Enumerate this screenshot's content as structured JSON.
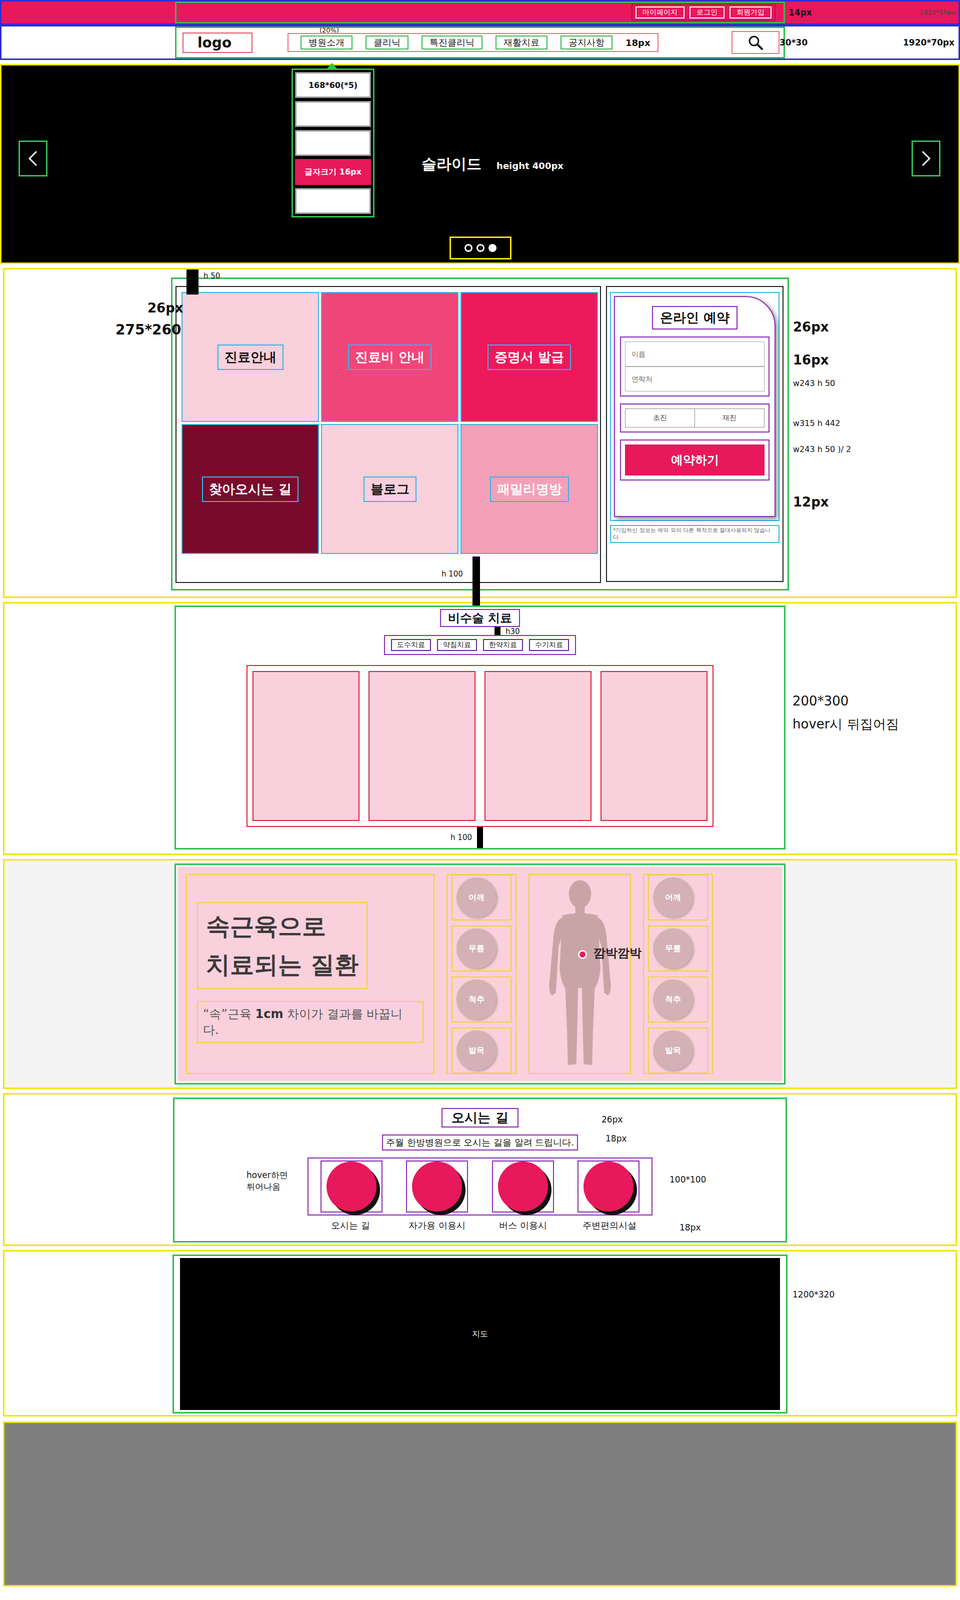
{
  "topBar": {
    "links": [
      {
        "label": "마이페이지"
      },
      {
        "label": "로그인"
      },
      {
        "label": "회원가입"
      }
    ],
    "fontNote": "14px",
    "sizeNote": "1920*50px"
  },
  "nav": {
    "logo": "logo",
    "items": [
      {
        "label": "병원소개",
        "expanded": true
      },
      {
        "label": "클리닉",
        "expanded": false
      },
      {
        "label": "특진클리닉",
        "expanded": false
      },
      {
        "label": "재활치료",
        "expanded": false
      },
      {
        "label": "공지사항",
        "expanded": false
      }
    ],
    "widthNote": "(20%)",
    "fontNote": "18px",
    "searchNote": "30*30",
    "sizeNote": "1920*70px"
  },
  "dropdown": {
    "items": [
      {
        "label": "168*60(*5)",
        "selected": false
      },
      {
        "label": "",
        "selected": false
      },
      {
        "label": "",
        "selected": false
      },
      {
        "label": "글자크기 16px",
        "selected": true
      },
      {
        "label": "",
        "selected": false
      }
    ]
  },
  "slider": {
    "title": "슬라이드",
    "heightNote": "height 400px",
    "dots": [
      {
        "selected": false
      },
      {
        "selected": false
      },
      {
        "selected": true
      }
    ]
  },
  "quick": {
    "fontNote": "26px",
    "sizeNote": "275*260",
    "topGapNote": "h 50",
    "bottomGapNote": "h 100",
    "tiles": [
      {
        "label": "진료안내",
        "color": "#f9d0dc"
      },
      {
        "label": "진료비 안내",
        "color": "#f0467a"
      },
      {
        "label": "증명서 발급",
        "color": "#ec1a5a"
      },
      {
        "label": "찾아오시는 길",
        "color": "#7a0a2c"
      },
      {
        "label": "블로그",
        "color": "#f9d0dc"
      },
      {
        "label": "패밀리명방",
        "color": "#f4a0b8"
      }
    ]
  },
  "reservation": {
    "title": "온라인 예약",
    "fields": [
      {
        "placeholder": "이름"
      },
      {
        "placeholder": "연락처"
      }
    ],
    "visitTypes": [
      {
        "label": "초진",
        "selected": false
      },
      {
        "label": "재진",
        "selected": false
      }
    ],
    "button": "예약하기",
    "notice": "*기입하신 정보는 예약 외의 다른 목적으로 절대사용되지 않습니다.",
    "notes": [
      "26px",
      "16px",
      "w243 h 50",
      "w315 h 442",
      "w243 h 50 )/ 2",
      "12px"
    ]
  },
  "treatment": {
    "title": "비수술 치료",
    "gapNote": "h30",
    "tabs": [
      {
        "label": "도수치료"
      },
      {
        "label": "약침치료"
      },
      {
        "label": "한약치료"
      },
      {
        "label": "수기치료"
      }
    ],
    "cards": [
      {
        "flipped": false
      },
      {
        "flipped": false
      },
      {
        "flipped": false
      },
      {
        "flipped": false
      }
    ],
    "sizeNote": "200*300",
    "hoverNote": "hover시 뒤집어짐",
    "bottomGapNote": "h 100"
  },
  "muscle": {
    "titleLines": [
      "속근육으로",
      "치료되는 질환"
    ],
    "subtitle": [
      {
        "text": "“속”근육 ",
        "bold": false
      },
      {
        "text": "1cm",
        "bold": true
      },
      {
        "text": " 차이가 결과를 바꿉니다.",
        "bold": false
      }
    ],
    "leftParts": [
      "어깨",
      "무릎",
      "척추",
      "발목"
    ],
    "rightParts": [
      "어깨",
      "무릎",
      "척추",
      "발목"
    ],
    "blinkLabel": "깜박깜박"
  },
  "directions": {
    "title": "오시는 길",
    "subtitle": "주월 한방병원으로 오시는 길을 알려 드립니다.",
    "items": [
      {
        "label": "오시는 길"
      },
      {
        "label": "자가용 이용시"
      },
      {
        "label": "버스 이용시"
      },
      {
        "label": "주변편의시설"
      }
    ],
    "titleNote": "26px",
    "subtitleNote": "18px",
    "sizeNote": "100*100",
    "labelNote": "18px",
    "hoverNote": [
      "hover하면",
      "튀어나옴"
    ]
  },
  "map": {
    "label": "지도",
    "sizeNote": "1200*320"
  }
}
